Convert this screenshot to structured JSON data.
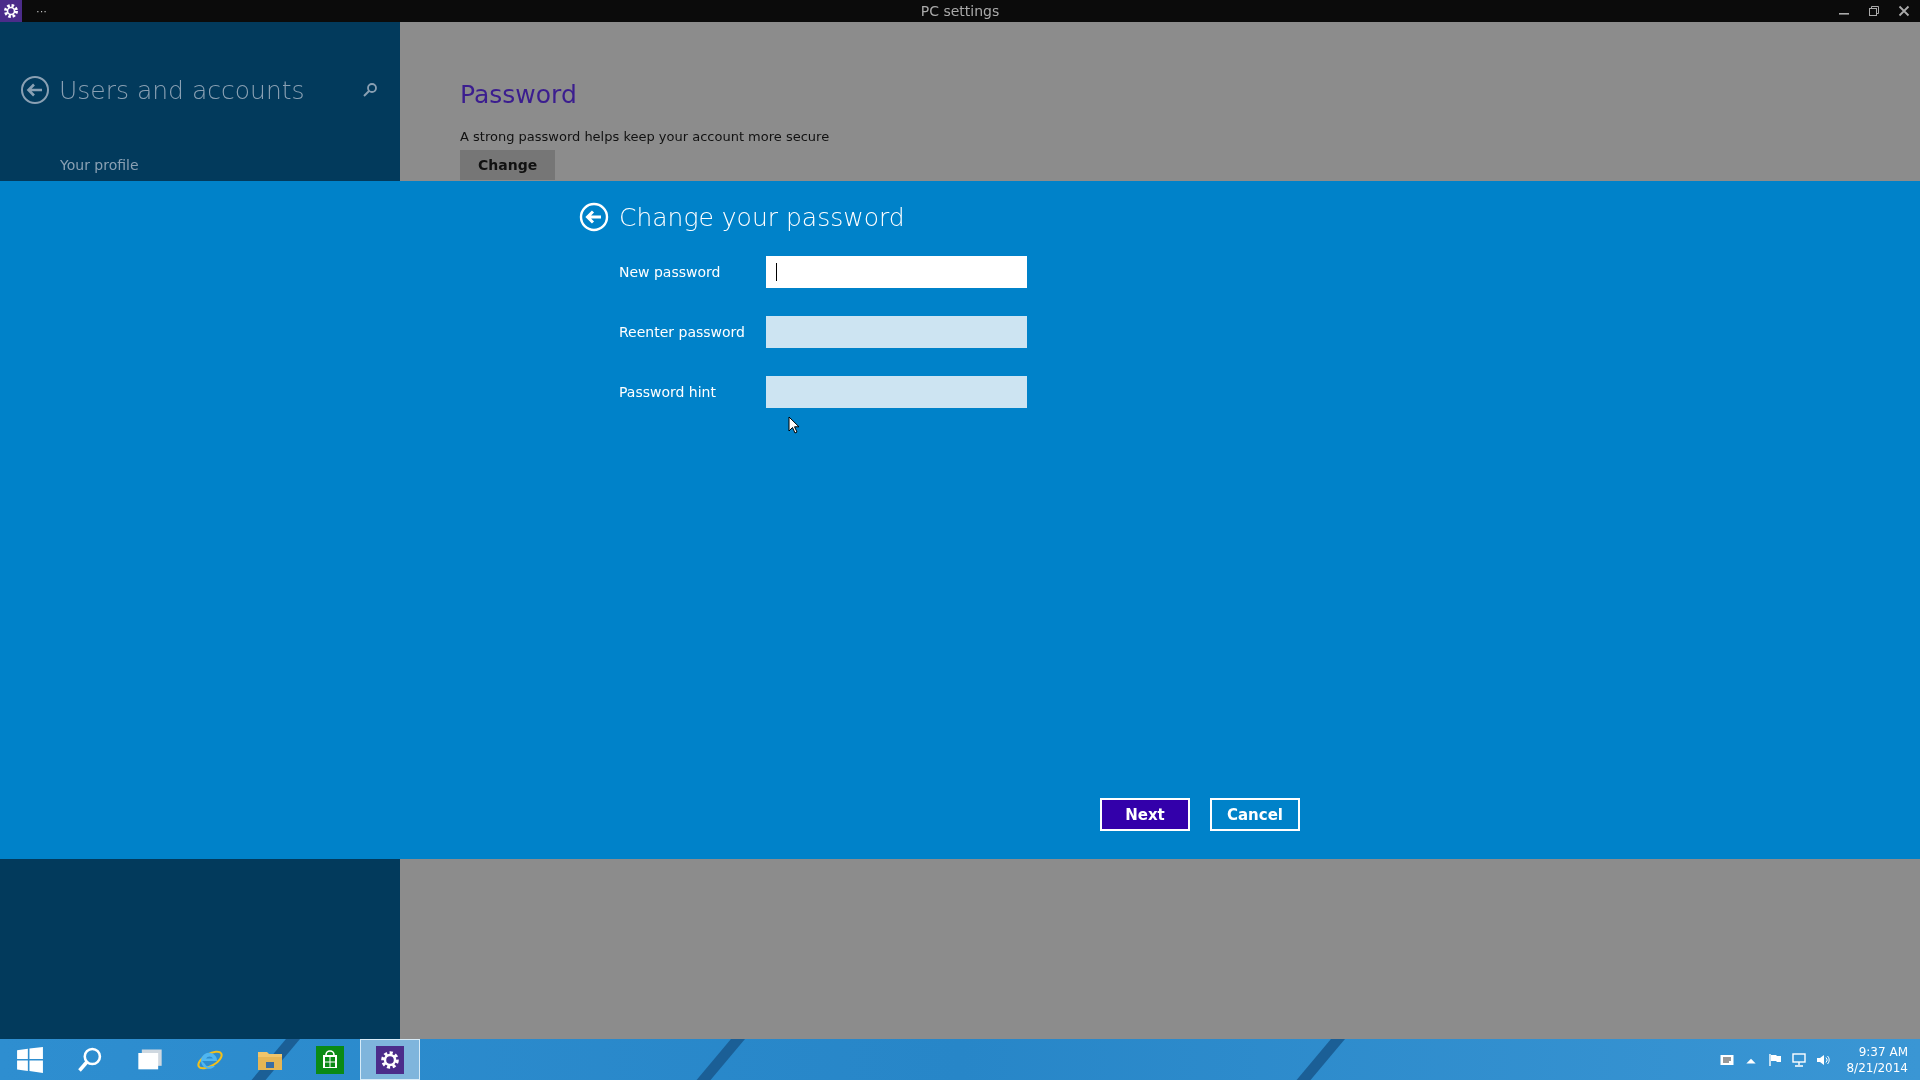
{
  "window": {
    "title": "PC settings",
    "menu": "···"
  },
  "sidebar": {
    "title": "Users and accounts",
    "items": [
      {
        "label": "Your profile",
        "selected": false
      }
    ]
  },
  "content": {
    "heading": "Password",
    "description": "A strong password helps keep your account more secure",
    "button": "Change"
  },
  "dialog": {
    "title": "Change your password",
    "fields": [
      {
        "label": "New password",
        "focused": true
      },
      {
        "label": "Reenter password",
        "focused": false
      },
      {
        "label": "Password hint",
        "focused": false
      }
    ],
    "buttons": [
      {
        "label": "Next",
        "kind": "primary"
      },
      {
        "label": "Cancel",
        "kind": "secondary"
      }
    ]
  },
  "taskbar": {
    "items": [
      {
        "kind": "start",
        "selected": false
      },
      {
        "kind": "search",
        "selected": false
      },
      {
        "kind": "taskview",
        "selected": false
      },
      {
        "kind": "browser",
        "selected": false
      },
      {
        "kind": "explorer",
        "selected": false
      },
      {
        "kind": "store",
        "selected": false
      },
      {
        "kind": "settings",
        "selected": true
      }
    ],
    "time": "9:37 AM",
    "date": "8/21/2014"
  }
}
